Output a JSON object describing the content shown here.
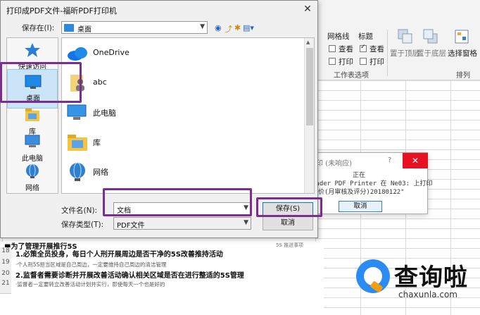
{
  "dialog": {
    "title": "打印成PDF文件-福昕PDF打印机",
    "save_in_label": "保存在(I):",
    "save_in_value": "桌面",
    "places": [
      {
        "label": "快速访问",
        "icon": "star-icon"
      },
      {
        "label": "桌面",
        "icon": "desktop-icon"
      },
      {
        "label": "库",
        "icon": "library-icon"
      },
      {
        "label": "此电脑",
        "icon": "computer-icon"
      },
      {
        "label": "网络",
        "icon": "network-icon"
      }
    ],
    "files": [
      {
        "name": "OneDrive",
        "icon": "onedrive-icon"
      },
      {
        "name": "abc",
        "icon": "user-folder-icon"
      },
      {
        "name": "此电脑",
        "icon": "computer-icon"
      },
      {
        "name": "库",
        "icon": "library-icon"
      },
      {
        "name": "网络",
        "icon": "network-icon"
      },
      {
        "name": "",
        "icon": "folder-icon"
      }
    ],
    "filename_label": "文件名(N):",
    "filename_value": "文档",
    "filetype_label": "保存类型(T):",
    "filetype_value": "PDF文件",
    "save_button": "保存(S)",
    "cancel_button": "取消"
  },
  "busy_dialog": {
    "title": "印 (未响应)",
    "question": "?",
    "line1": "正在",
    "line2": "eader PDF Printer 在 Ne03: 上打印",
    "line3": "评价(月审核及评分)20180122\"",
    "cancel_button": "取消"
  },
  "ribbon": {
    "gridlines_label": "网格线",
    "headings_label": "标题",
    "view_label": "查看",
    "print_label": "打印",
    "gridlines_view": false,
    "headings_view": true,
    "gridlines_print": false,
    "headings_print": false,
    "group_label": "工作表选项",
    "bring_forward": "置于顶层",
    "send_backward": "置于底层",
    "selection_pane": "选择窗格",
    "arrange_label": "排列"
  },
  "sheet": {
    "header_line": "■为了管理开展推行5S",
    "rows": [
      {
        "num": "18",
        "text": "1.必策全员投身，每日个人刑开展周边是否干净的5S改善推持活动",
        "style": "bold"
      },
      {
        "num": "19",
        "text": "·个人刑5S担当区域是自己周边，一定要维持自己周边的清洁管理",
        "style": "small"
      },
      {
        "num": "20",
        "text": "2.监督者需要诊断并开展改善活动确认相关区域是否在进行整适的5S管理",
        "style": "bold"
      },
      {
        "num": "21",
        "text": "·监督者一定要转立改善活动计划并实行，即使每天一个也是好的",
        "style": "small"
      }
    ],
    "right_note": "5S 推进事项"
  },
  "watermark": {
    "text": "查询啦",
    "url": "chaxunla.com"
  },
  "colors": {
    "highlight": "#7b2e8f",
    "selection": "#cce4f7",
    "close_red": "#e81123",
    "brand_blue": "#2a8cf2"
  }
}
